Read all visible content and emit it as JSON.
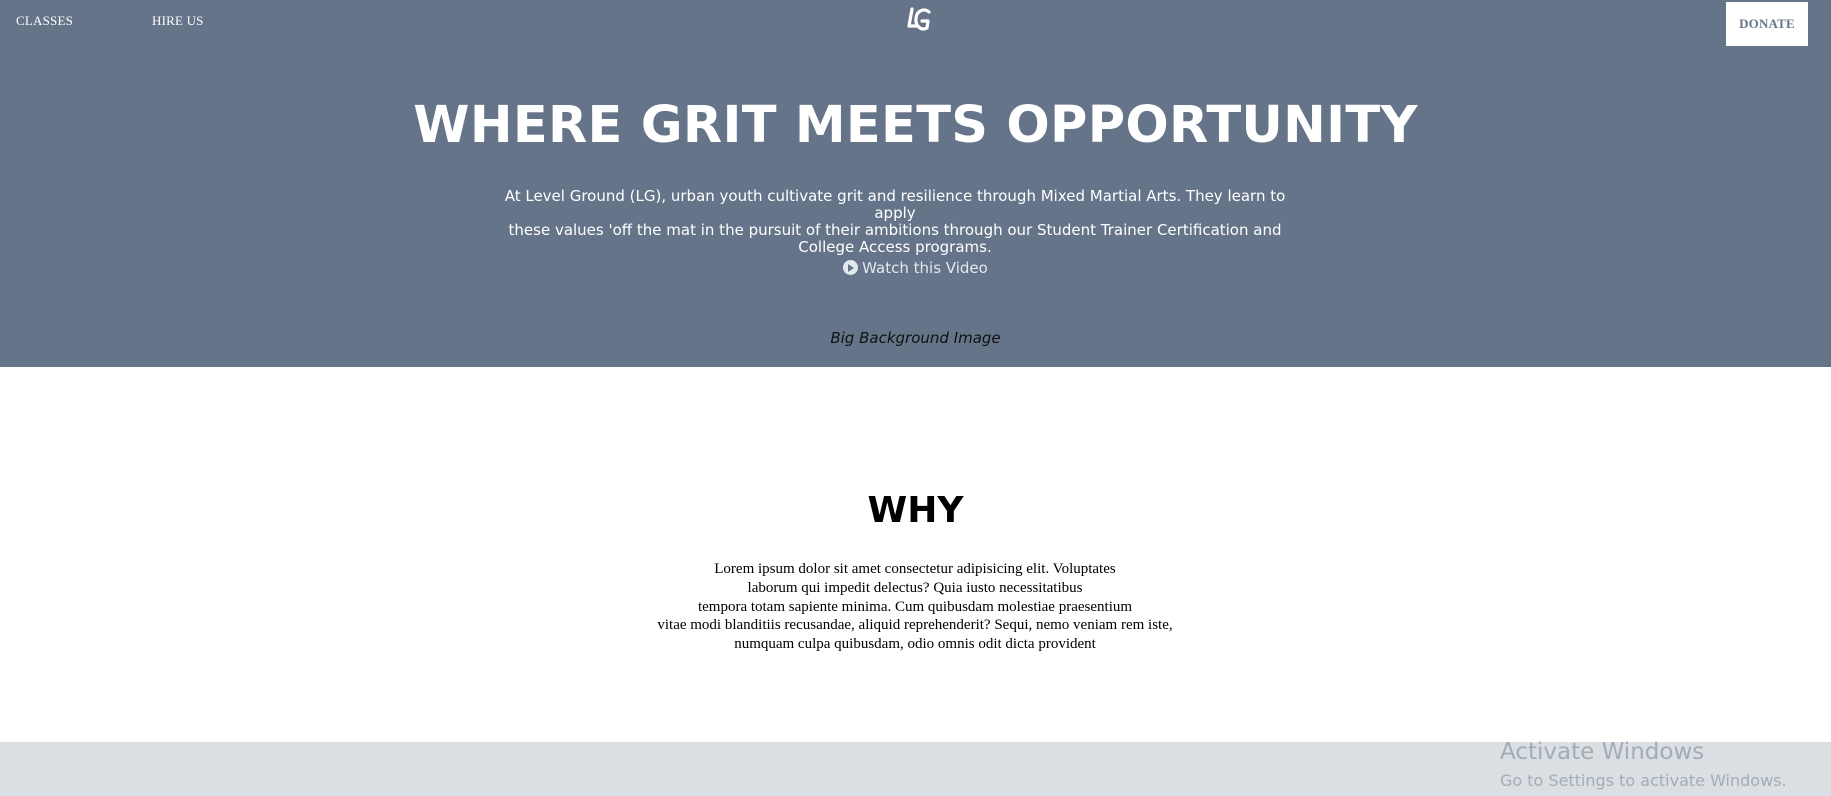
{
  "nav": {
    "classes_label": "CLASSES",
    "hire_label": "HIRE US",
    "logo_name": "lg-logo",
    "donate_label": "DONATE"
  },
  "hero": {
    "title": "WHERE GRIT MEETS OPPORTUNITY",
    "description_lines": [
      "At Level Ground (LG), urban youth cultivate grit and resilience through Mixed Martial Arts. They learn to apply",
      "these values 'off the mat in the pursuit of their ambitions through our Student Trainer Certification and",
      "College Access programs."
    ],
    "watch_label": "Watch this Video",
    "watch_icon": "play-circle-icon",
    "background_caption": "Big Background Image",
    "background_color": "#657489"
  },
  "why": {
    "title": "WHY",
    "body_lines": [
      "Lorem ipsum dolor sit amet consectetur adipisicing elit. Voluptates",
      "laborum qui impedit delectus? Quia iusto necessitatibus",
      "tempora totam sapiente minima. Cum quibusdam molestiae praesentium",
      "vitae modi blanditiis recusandae, aliquid reprehenderit? Sequi, nemo veniam rem iste,",
      "numquam culpa quibusdam, odio omnis odit dicta provident"
    ]
  },
  "footer": {
    "band_color": "#dadfe3"
  },
  "watermark": {
    "line1": "Activate Windows",
    "line2": "Go to Settings to activate Windows."
  }
}
